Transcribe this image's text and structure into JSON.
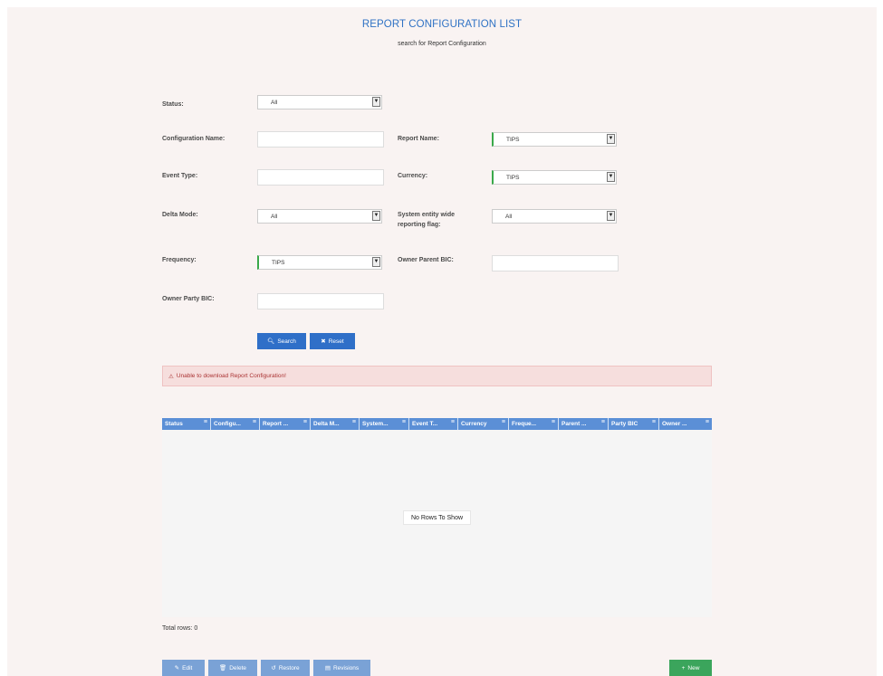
{
  "header": {
    "title": "REPORT CONFIGURATION LIST",
    "subtitle": "search for Report Configuration"
  },
  "form": {
    "status_label": "Status:",
    "status_value": "All",
    "config_name_label": "Configuration Name:",
    "config_name_value": "",
    "report_name_label": "Report Name:",
    "report_name_value": "TIPS",
    "event_type_label": "Event Type:",
    "event_type_value": "",
    "currency_label": "Currency:",
    "currency_value": "TIPS",
    "delta_mode_label": "Delta Mode:",
    "delta_mode_value": "All",
    "system_flag_label": "System entity wide reporting flag:",
    "system_flag_value": "All",
    "frequency_label": "Frequency:",
    "frequency_value": "TIPS",
    "owner_parent_bic_label": "Owner Parent BIC:",
    "owner_parent_bic_value": "",
    "owner_party_bic_label": "Owner Party BIC:",
    "owner_party_bic_value": ""
  },
  "buttons": {
    "search_label": "Search",
    "reset_label": "Reset"
  },
  "alert": {
    "text": "Unable to download Report Configuration!"
  },
  "grid": {
    "columns": [
      "Status",
      "Configu...",
      "Report ...",
      "Delta M...",
      "System...",
      "Event T...",
      "Currency",
      "Freque...",
      "Parent ...",
      "Party BIC",
      "Owner ..."
    ],
    "empty_text": "No Rows To Show",
    "total_text": "Total rows: 0"
  },
  "footer": {
    "edit_label": "Edit",
    "delete_label": "Delete",
    "restore_label": "Restore",
    "revisions_label": "Revisions",
    "new_label": "New"
  },
  "colors": {
    "accent_blue": "#2f6fc8",
    "header_blue": "#5b8fd6",
    "required_green": "#3aa94a",
    "new_green": "#3ba55c",
    "alert_bg": "#f6dedd"
  }
}
